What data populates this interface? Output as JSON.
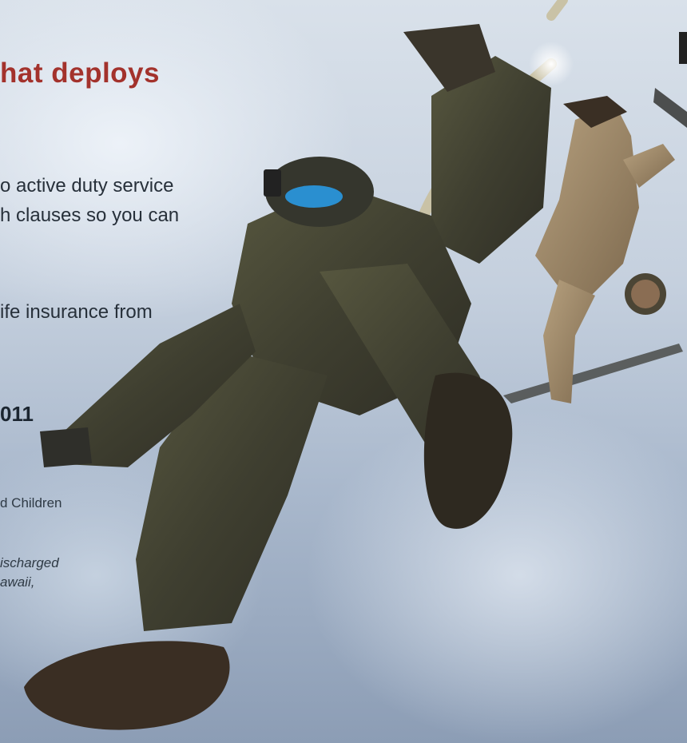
{
  "headline": "hat deploys",
  "body_lines": [
    "o active duty service",
    "h clauses so you can",
    "ife insurance from"
  ],
  "year_fragment": "011",
  "small_line": "d Children",
  "italic_lines": [
    "ischarged",
    "awaii,"
  ],
  "photo": {
    "icon": "parachute-jump-photo",
    "colors": {
      "sky_light": "#d9e1ea",
      "sky_dark": "#8c9db5",
      "camo": "#4a4a3a",
      "tan_uniform": "#9a8468",
      "headline_red": "#a3322c"
    }
  }
}
